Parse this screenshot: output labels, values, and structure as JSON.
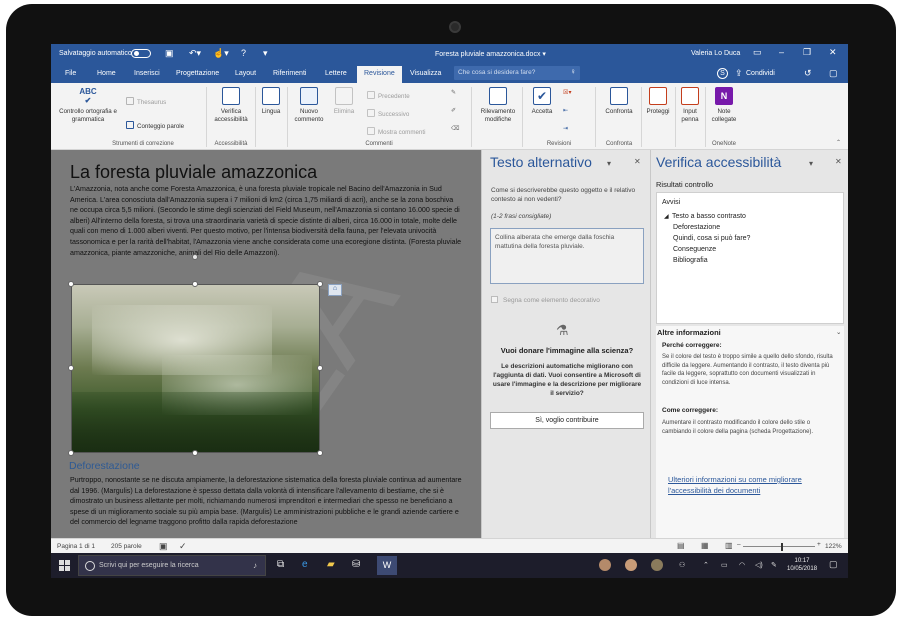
{
  "window": {
    "autosave_label": "Salvataggio automatico",
    "doc_title": "Foresta pluviale amazzonica.docx ▾",
    "user": "Valeria Lo Duca"
  },
  "tabs": [
    "File",
    "Home",
    "Inserisci",
    "Progettazione",
    "Layout",
    "Riferimenti",
    "Lettere",
    "Revisione",
    "Visualizza"
  ],
  "active_tab": "Revisione",
  "search_placeholder": "Che cosa si desidera fare?",
  "share_label": "Condividi",
  "ribbon": {
    "spelling": "Controllo ortografia e grammatica",
    "thesaurus": "Thesaurus",
    "word_count": "Conteggio parole",
    "group_proofing": "Strumenti di correzione",
    "check_accessibility": "Verifica accessibilità",
    "group_accessibility": "Accessibilità",
    "language": "Lingua",
    "new_comment": "Nuovo commento",
    "delete": "Elimina",
    "previous": "Precedente",
    "next": "Successivo",
    "show_comments": "Mostra commenti",
    "group_comments": "Commenti",
    "track_changes": "Rilevamento modifiche",
    "accept": "Accetta",
    "group_revisions": "Revisioni",
    "compare": "Confronta",
    "group_compare": "Confronta",
    "protect": "Proteggi",
    "ink": "Input penna",
    "onenote": "Note collegate",
    "group_onenote": "OneNote"
  },
  "document": {
    "title": "La foresta pluviale amazzonica",
    "para1": "L'Amazzonia, nota anche come Foresta Amazzonica, è una foresta pluviale tropicale nel Bacino dell'Amazzonia in Sud America. L'area conosciuta dall'Amazzonia supera i 7 milioni di km2 (circa 1,75 miliardi di acri), anche se la zona boschiva ne occupa circa 5,5 milioni. (Secondo le stime degli scienziati del Field Museum, nell'Amazzonia si contano 16.000 specie di alberi) All'interno della foresta, si trova una straordinaria varietà di specie distinte di alberi, circa 16.000 in totale, molte delle quali con meno di 1.000 alberi viventi. Per questo motivo, per l'intensa biodiversità della fauna, per l'elevata univocità tassonomica e per la rarità dell'habitat, l'Amazzonia viene anche considerata come una ecoregione distinta. (Foresta pluviale amazzonica, piante amazzoniche, animali del Rio delle Amazzoni).",
    "heading2": "Deforestazione",
    "para2": "Purtroppo, nonostante se ne discuta ampiamente, la deforestazione sistematica della foresta pluviale continua ad aumentare dal 1996. (Margulis) La deforestazione è spesso dettata dalla volontà di intensificare l'allevamento di bestiame, che si è dimostrato un business allettante per molti, richiamando numerosi imprenditori e intermediari che spesso ne beneficiano a spese di un miglioramento sociale su più ampia base. (Margulis) Le amministrazioni pubbliche e le grandi aziende cartiere e del commercio del legname traggono profitto dalla rapida deforestazione"
  },
  "alt_pane": {
    "title": "Testo alternativo",
    "question": "Come si descriverebbe questo oggetto e il relativo contesto ai non vedenti?",
    "hint": "(1-2 frasi consigliate)",
    "alt_text": "Collina alberata che emerge dalla foschia mattutina della foresta pluviale.",
    "decorative": "Segna come elemento decorativo",
    "donate_title": "Vuoi donare l'immagine alla scienza?",
    "donate_body": "Le descrizioni automatiche migliorano con l'aggiunta di dati. Vuoi consentire a Microsoft di usare l'immagine e la descrizione per migliorare il servizio?",
    "contribute": "Sì, voglio contribuire"
  },
  "acc_pane": {
    "title": "Verifica accessibilità",
    "results_label": "Risultati controllo",
    "warnings": "Avvisi",
    "issue": "Testo a basso contrasto",
    "items": [
      "Deforestazione",
      "Quindi, cosa si può fare?",
      "Conseguenze",
      "Bibliografia"
    ],
    "more_info": "Altre informazioni",
    "why_fix": "Perché correggere:",
    "why_text": "Se il colore del testo è troppo simile a quello dello sfondo, risulta difficile da leggere. Aumentando il contrasto, il testo diventa più facile da leggere, soprattutto con documenti visualizzati in condizioni di luce intensa.",
    "how_fix": "Come correggere:",
    "how_text": "Aumentare il contrasto modificando il colore dello stile o cambiando il colore della pagina (scheda Progettazione).",
    "link": "Ulteriori informazioni su come migliorare l'accessibilità dei documenti"
  },
  "status": {
    "page": "Pagina 1 di 1",
    "words": "205 parole",
    "zoom": "122%"
  },
  "taskbar": {
    "search": "Scrivi qui per eseguire la ricerca",
    "time": "10:17",
    "date": "10/05/2018"
  },
  "colors": {
    "word_blue": "#2b579a",
    "doc_bg": "#7a7a7a"
  }
}
